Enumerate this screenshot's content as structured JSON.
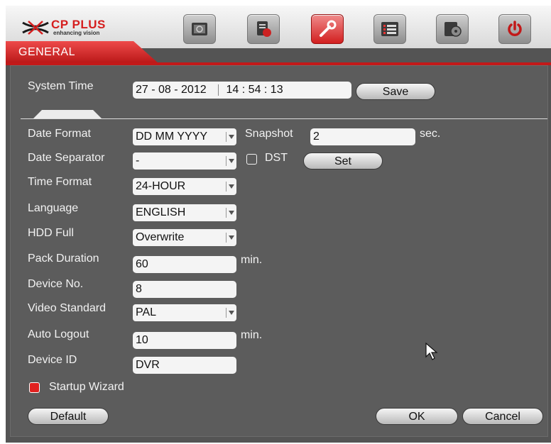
{
  "logo": {
    "brand": "CP PLUS",
    "tagline": "enhancing vision"
  },
  "toolbar": [
    {
      "name": "search-tab",
      "icon": "search-icon"
    },
    {
      "name": "info-tab",
      "icon": "info-icon"
    },
    {
      "name": "setting-tab",
      "icon": "wrench-icon",
      "active": true
    },
    {
      "name": "advanced-tab",
      "icon": "list-icon"
    },
    {
      "name": "backup-tab",
      "icon": "backup-icon"
    },
    {
      "name": "shutdown-tab",
      "icon": "power-icon"
    }
  ],
  "tab": {
    "title": "GENERAL"
  },
  "system_time": {
    "label": "System Time",
    "date": "27 - 08 - 2012",
    "time": "14 : 54 : 13",
    "save_label": "Save"
  },
  "form": {
    "date_format": {
      "label": "Date Format",
      "value": "DD MM YYYY"
    },
    "snapshot": {
      "label": "Snapshot",
      "value": "2",
      "unit": "sec."
    },
    "date_separator": {
      "label": "Date Separator",
      "value": "-"
    },
    "dst": {
      "label": "DST",
      "checked": false,
      "set_label": "Set"
    },
    "time_format": {
      "label": "Time Format",
      "value": "24-HOUR"
    },
    "language": {
      "label": "Language",
      "value": "ENGLISH"
    },
    "hdd_full": {
      "label": "HDD Full",
      "value": "Overwrite"
    },
    "pack_duration": {
      "label": "Pack Duration",
      "value": "60",
      "unit": "min."
    },
    "device_no": {
      "label": "Device No.",
      "value": "8"
    },
    "video_standard": {
      "label": "Video Standard",
      "value": "PAL"
    },
    "auto_logout": {
      "label": "Auto Logout",
      "value": "10",
      "unit": "min."
    },
    "device_id": {
      "label": "Device ID",
      "value": "DVR"
    },
    "startup_wizard": {
      "label": "Startup Wizard",
      "checked": true
    }
  },
  "footer": {
    "default_label": "Default",
    "ok_label": "OK",
    "cancel_label": "Cancel"
  },
  "colors": {
    "accent": "#d21f1f",
    "panel": "#5c5c5c",
    "text": "#f2f2f2"
  }
}
